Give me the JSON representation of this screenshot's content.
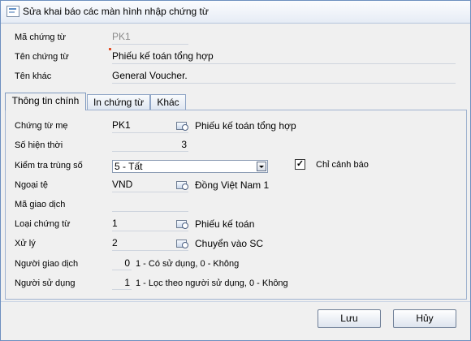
{
  "window": {
    "title": "Sửa khai báo các màn hình nhập chứng từ"
  },
  "header": {
    "ma_chung_tu": {
      "label": "Mã chứng từ",
      "value": "PK1"
    },
    "ten_chung_tu": {
      "label": "Tên chứng từ",
      "value": "Phiếu kế toán tổng hợp"
    },
    "ten_khac": {
      "label": "Tên khác",
      "value": "General Voucher."
    }
  },
  "tabs": [
    {
      "label": "Thông tin chính"
    },
    {
      "label": "In chứng từ"
    },
    {
      "label": "Khác"
    }
  ],
  "main": {
    "chung_tu_me": {
      "label": "Chứng từ mẹ",
      "value": "PK1",
      "description": "Phiếu kế toán tổng hợp"
    },
    "so_hien_thoi": {
      "label": "Số hiện thời",
      "value": "3"
    },
    "kiem_tra_trung_so": {
      "label": "Kiểm tra trùng số",
      "value": "5 - Tất"
    },
    "chi_canh_bao": {
      "label": "Chỉ cảnh báo",
      "mark": "✓"
    },
    "ngoai_te": {
      "label": "Ngoại tệ",
      "value": "VND",
      "description": "Đồng Việt Nam 1"
    },
    "ma_giao_dich": {
      "label": "Mã giao dịch",
      "value": ""
    },
    "loai_chung_tu": {
      "label": "Loại chứng từ",
      "value": "1",
      "description": "Phiếu kế toán"
    },
    "xu_ly": {
      "label": "Xử lý",
      "value": "2",
      "description": "Chuyển vào SC"
    },
    "nguoi_giao_dich": {
      "label": "Người giao dịch",
      "value": "0",
      "description": "1 - Có sử dụng, 0 - Không"
    },
    "nguoi_su_dung": {
      "label": "Người sử dụng",
      "value": "1",
      "description": "1 - Lọc theo người sử dụng, 0 - Không"
    }
  },
  "buttons": {
    "save": "Lưu",
    "cancel": "Hủy"
  }
}
